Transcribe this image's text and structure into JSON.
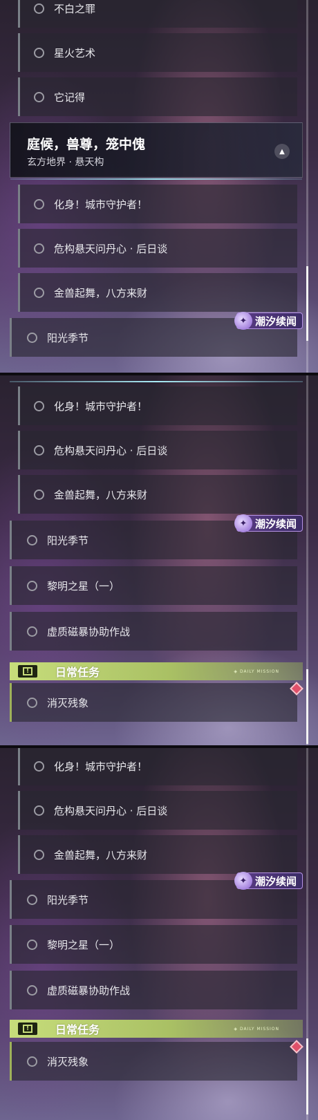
{
  "panel1": {
    "top_quests": [
      {
        "label": "不白之罪"
      },
      {
        "label": "星火艺术"
      },
      {
        "label": "它记得"
      }
    ],
    "header": {
      "title": "庭候，兽尊，笼中傀",
      "subtitle": "玄方地界 · 悬天构"
    },
    "sub_quests": [
      {
        "label": "化身！城市守护者！"
      },
      {
        "label": "危构悬天问丹心 · 后日谈"
      },
      {
        "label": "金兽起舞，八方来财"
      }
    ],
    "tagged_quest": {
      "label": "阳光季节",
      "tag": "潮汐续闻"
    }
  },
  "panel2": {
    "sub_quests": [
      {
        "label": "化身！城市守护者！"
      },
      {
        "label": "危构悬天问丹心 · 后日谈"
      },
      {
        "label": "金兽起舞，八方来财"
      }
    ],
    "tagged_quest": {
      "label": "阳光季节",
      "tag": "潮汐续闻"
    },
    "quests": [
      {
        "label": "黎明之星（一）"
      },
      {
        "label": "虚质磁暴协助作战"
      }
    ],
    "daily": {
      "title": "日常任务",
      "badge_text": "◈ DAILY MISSION",
      "items": [
        {
          "label": "消灭残象"
        }
      ]
    }
  },
  "panel3": {
    "sub_quests": [
      {
        "label": "化身！城市守护者！"
      },
      {
        "label": "危构悬天问丹心 · 后日谈"
      },
      {
        "label": "金兽起舞，八方来财"
      }
    ],
    "tagged_quest": {
      "label": "阳光季节",
      "tag": "潮汐续闻"
    },
    "quests": [
      {
        "label": "黎明之星（一）"
      },
      {
        "label": "虚质磁暴协助作战"
      }
    ],
    "daily": {
      "title": "日常任务",
      "badge_text": "◈ DAILY MISSION",
      "items": [
        {
          "label": "消灭残象"
        }
      ]
    }
  },
  "icons": {
    "radio": "radio-circle-icon",
    "tag": "tide-icon",
    "daily": "alert-box-icon",
    "collapse": "chevron-up-icon",
    "new": "diamond-marker-icon"
  },
  "colors": {
    "daily_accent": "#c7dd7b",
    "tag_purple": "#5b3c86",
    "cyan_line": "#9fe6f2",
    "marker_red": "#e0506a"
  }
}
